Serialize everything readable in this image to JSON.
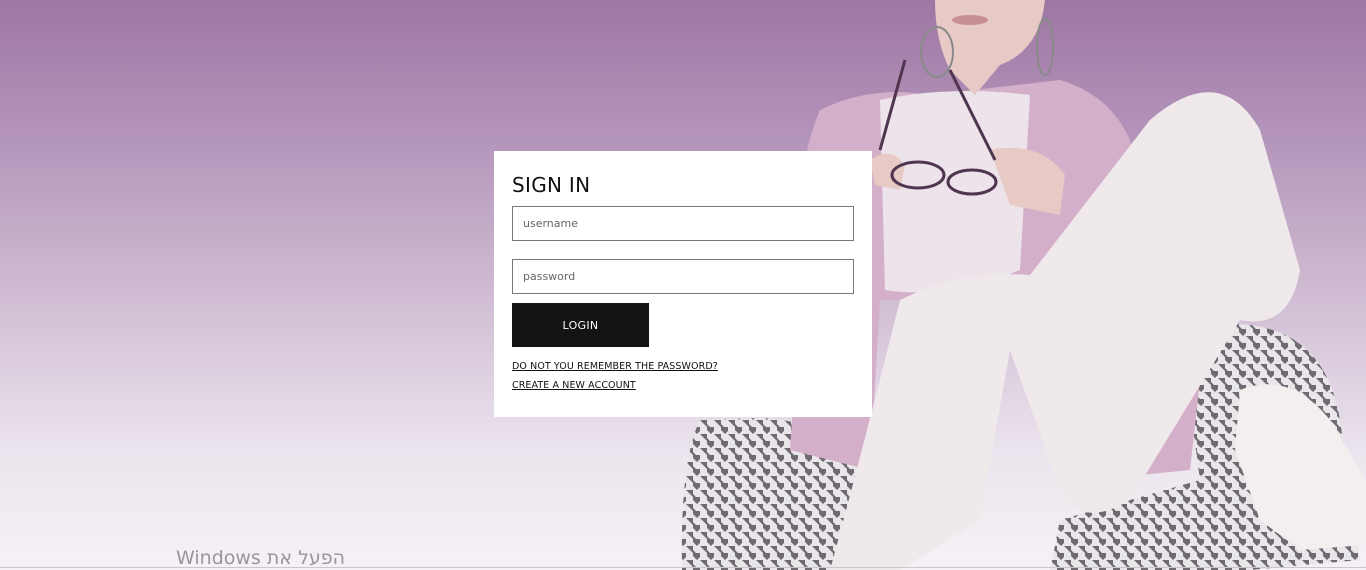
{
  "signin": {
    "title": "SIGN IN",
    "username_placeholder": "username",
    "password_placeholder": "password",
    "login_label": "LOGIN",
    "forgot_link": "DO NOT YOU REMEMBER THE PASSWORD?",
    "create_link": "CREATE A NEW ACCOUNT"
  },
  "os": {
    "activation_watermark": "הפעל את Windows"
  },
  "colors": {
    "background_top": "#9d77a3",
    "background_bottom": "#f5f1f6",
    "button": "#141414",
    "card": "#ffffff"
  }
}
